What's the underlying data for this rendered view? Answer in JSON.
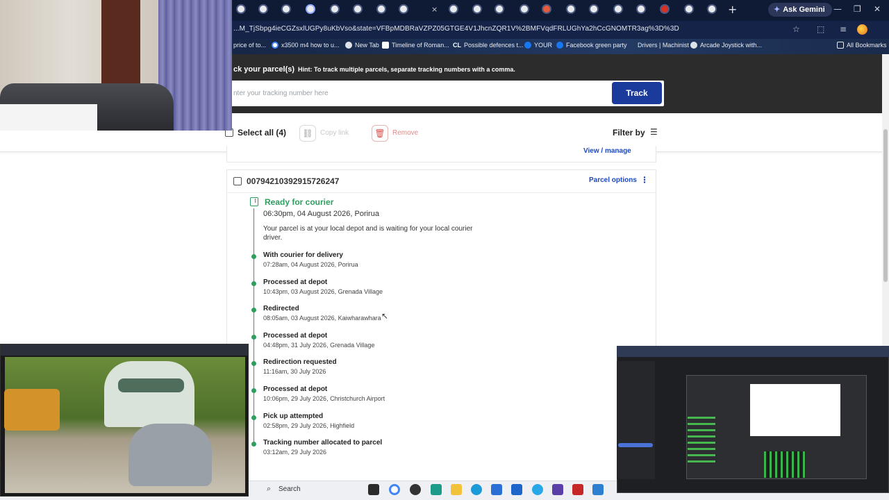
{
  "browser": {
    "url": "...M_TjSbpg4ieCGZsxlUGPy8uKbVso&state=VFBpMDBRaVZPZ05GTGE4V1JhcnZQR1V%2BMFVqdFRLUGhYa2hCcGNOMTR3ag%3D%3D",
    "ask_gemini": "Ask Gemini",
    "bookmarks": [
      {
        "label": "price of to...",
        "icon": "page"
      },
      {
        "label": "x3500 m4 how to u...",
        "icon": "google"
      },
      {
        "label": "New Tab",
        "icon": "page"
      },
      {
        "label": "Timeline of Roman...",
        "icon": "wiki"
      },
      {
        "label": "Possible defences t...",
        "icon": "cl"
      },
      {
        "label": "YOUR",
        "icon": "facebook"
      },
      {
        "label": "Facebook green party",
        "icon": "facebook"
      },
      {
        "label": "Drivers | Machinist",
        "icon": "page"
      },
      {
        "label": "Arcade Joystick with...",
        "icon": "page"
      },
      {
        "label": "All Bookmarks",
        "icon": "folder"
      }
    ]
  },
  "tracking_form": {
    "title": "ck your parcel(s)",
    "hint": "Hint: To track multiple parcels, separate tracking numbers with a comma.",
    "input_placeholder": "nter your tracking number here",
    "track_button": "Track"
  },
  "toolbar": {
    "select_all": "Select all (4)",
    "copy_link": "Copy link",
    "remove": "Remove",
    "filter_by": "Filter by"
  },
  "previous_card": {
    "view_manage": "View / manage"
  },
  "parcel": {
    "tracking_number": "00794210392915726247",
    "options_label": "Parcel options",
    "current": {
      "status": "Ready for courier",
      "datetime": "06:30pm, 04 August 2026, Porirua",
      "description": "Your parcel is at your local depot and is waiting for your local courier driver."
    },
    "events": [
      {
        "title": "With courier for delivery",
        "datetime": "07:28am, 04 August 2026, Porirua"
      },
      {
        "title": "Processed at depot",
        "datetime": "10:43pm, 03 August 2026, Grenada Village"
      },
      {
        "title": "Redirected",
        "datetime": "08:05am, 03 August 2026, Kaiwharawhara"
      },
      {
        "title": "Processed at depot",
        "datetime": "04:48pm, 31 July 2026, Grenada Village"
      },
      {
        "title": "Redirection requested",
        "datetime": "11:16am, 30 July 2026"
      },
      {
        "title": "Processed at depot",
        "datetime": "10:06pm, 29 July 2026, Christchurch Airport"
      },
      {
        "title": "Pick up attempted",
        "datetime": "02:58pm, 29 July 2026, Highfield"
      },
      {
        "title": "Tracking number allocated to parcel",
        "datetime": "03:12am, 29 July 2026"
      }
    ]
  },
  "taskbar": {
    "search": "Search"
  },
  "colors": {
    "accent_blue": "#1a3a9c",
    "link_blue": "#1a47c4",
    "status_green": "#2e9e5e",
    "header_dark": "#2c2c2c"
  }
}
